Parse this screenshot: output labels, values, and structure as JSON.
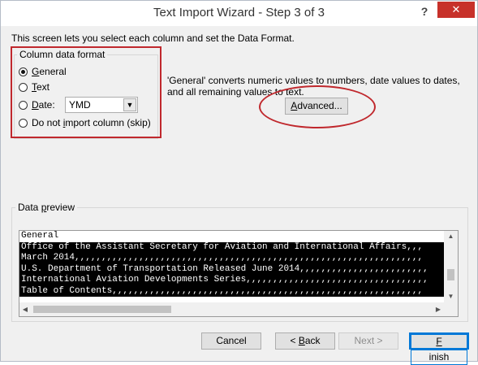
{
  "window": {
    "title": "Text Import Wizard - Step 3 of 3",
    "help_label": "?",
    "close_label": "✕"
  },
  "intro": "This screen lets you select each column and set the Data Format.",
  "column_format": {
    "legend": "Column data format",
    "options": [
      {
        "pre": "",
        "key": "G",
        "post": "eneral",
        "selected": true
      },
      {
        "pre": "",
        "key": "T",
        "post": "ext",
        "selected": false
      },
      {
        "pre": "",
        "key": "D",
        "post": "ate:",
        "selected": false
      },
      {
        "pre": "Do not ",
        "key": "i",
        "post": "mport column (skip)",
        "selected": false
      }
    ],
    "date_value": "YMD"
  },
  "description": "'General' converts numeric values to numbers, date values to dates, and all remaining values to text.",
  "advanced": {
    "key": "A",
    "rest": "dvanced..."
  },
  "preview": {
    "legend_pre": "Data ",
    "legend_key": "p",
    "legend_post": "review",
    "header": "General",
    "lines": [
      "Office of the Assistant Secretary for Aviation and International Affairs,,,",
      "March 2014,,,,,,,,,,,,,,,,,,,,,,,,,,,,,,,,,,,,,,,,,,,,,,,,,,,,,,,,,,,,,,,,,",
      "U.S. Department of Transportation Released June 2014,,,,,,,,,,,,,,,,,,,,,,,,",
      "International Aviation Developments Series,,,,,,,,,,,,,,,,,,,,,,,,,,,,,,,,,,",
      "Table of Contents,,,,,,,,,,,,,,,,,,,,,,,,,,,,,,,,,,,,,,,,,,,,,,,,,,,,,,,,,,"
    ]
  },
  "buttons": {
    "cancel": "Cancel",
    "back_arrow": "< ",
    "back_key": "B",
    "back_rest": "ack",
    "next": "Next >",
    "finish_key": "F",
    "finish_rest": "inish"
  },
  "colors": {
    "highlight_red": "#c0282d",
    "close_red": "#c7312a",
    "focus_blue": "#0078d7"
  }
}
